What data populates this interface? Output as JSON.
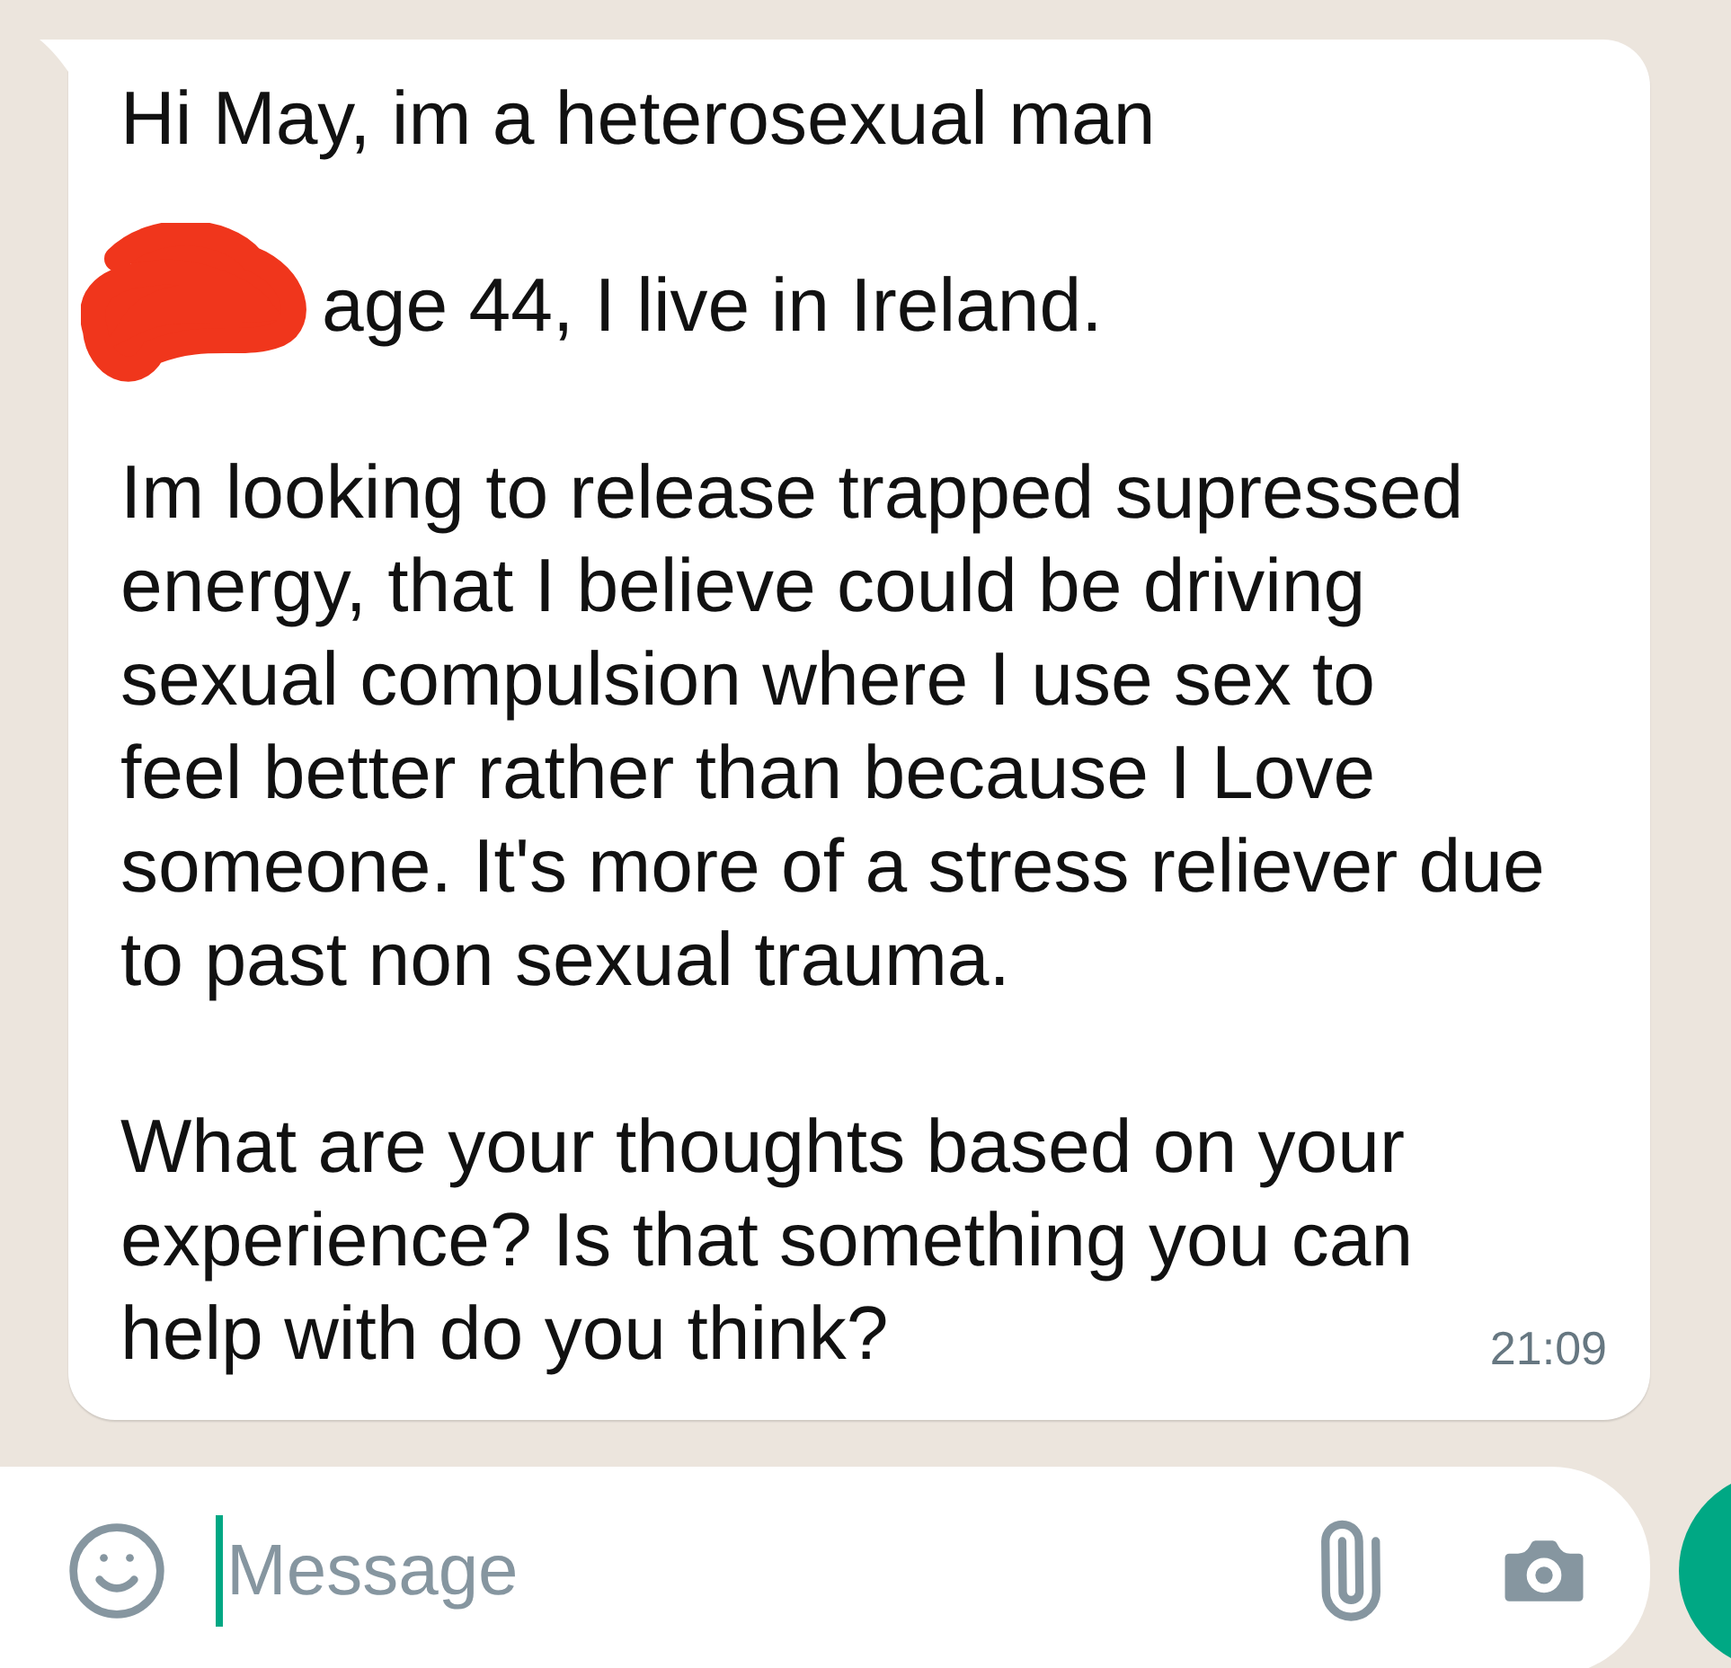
{
  "message": {
    "paragraphs": [
      {
        "kind": "text",
        "text": "Hi May, im a heterosexual man"
      },
      {
        "kind": "redacted",
        "text": "age 44, I live in Ireland."
      },
      {
        "kind": "text",
        "text": "Im looking to release trapped supressed\nenergy, that I believe could be driving\nsexual compulsion where I use sex to\nfeel better rather than because I Love\nsomeone. It's more of a stress reliever due\nto past non sexual trauma."
      },
      {
        "kind": "text",
        "text": "What are your thoughts based on your\nexperience? Is that something you can\nhelp with do you think?"
      }
    ],
    "time": "21:09"
  },
  "composer": {
    "placeholder": "Message"
  }
}
